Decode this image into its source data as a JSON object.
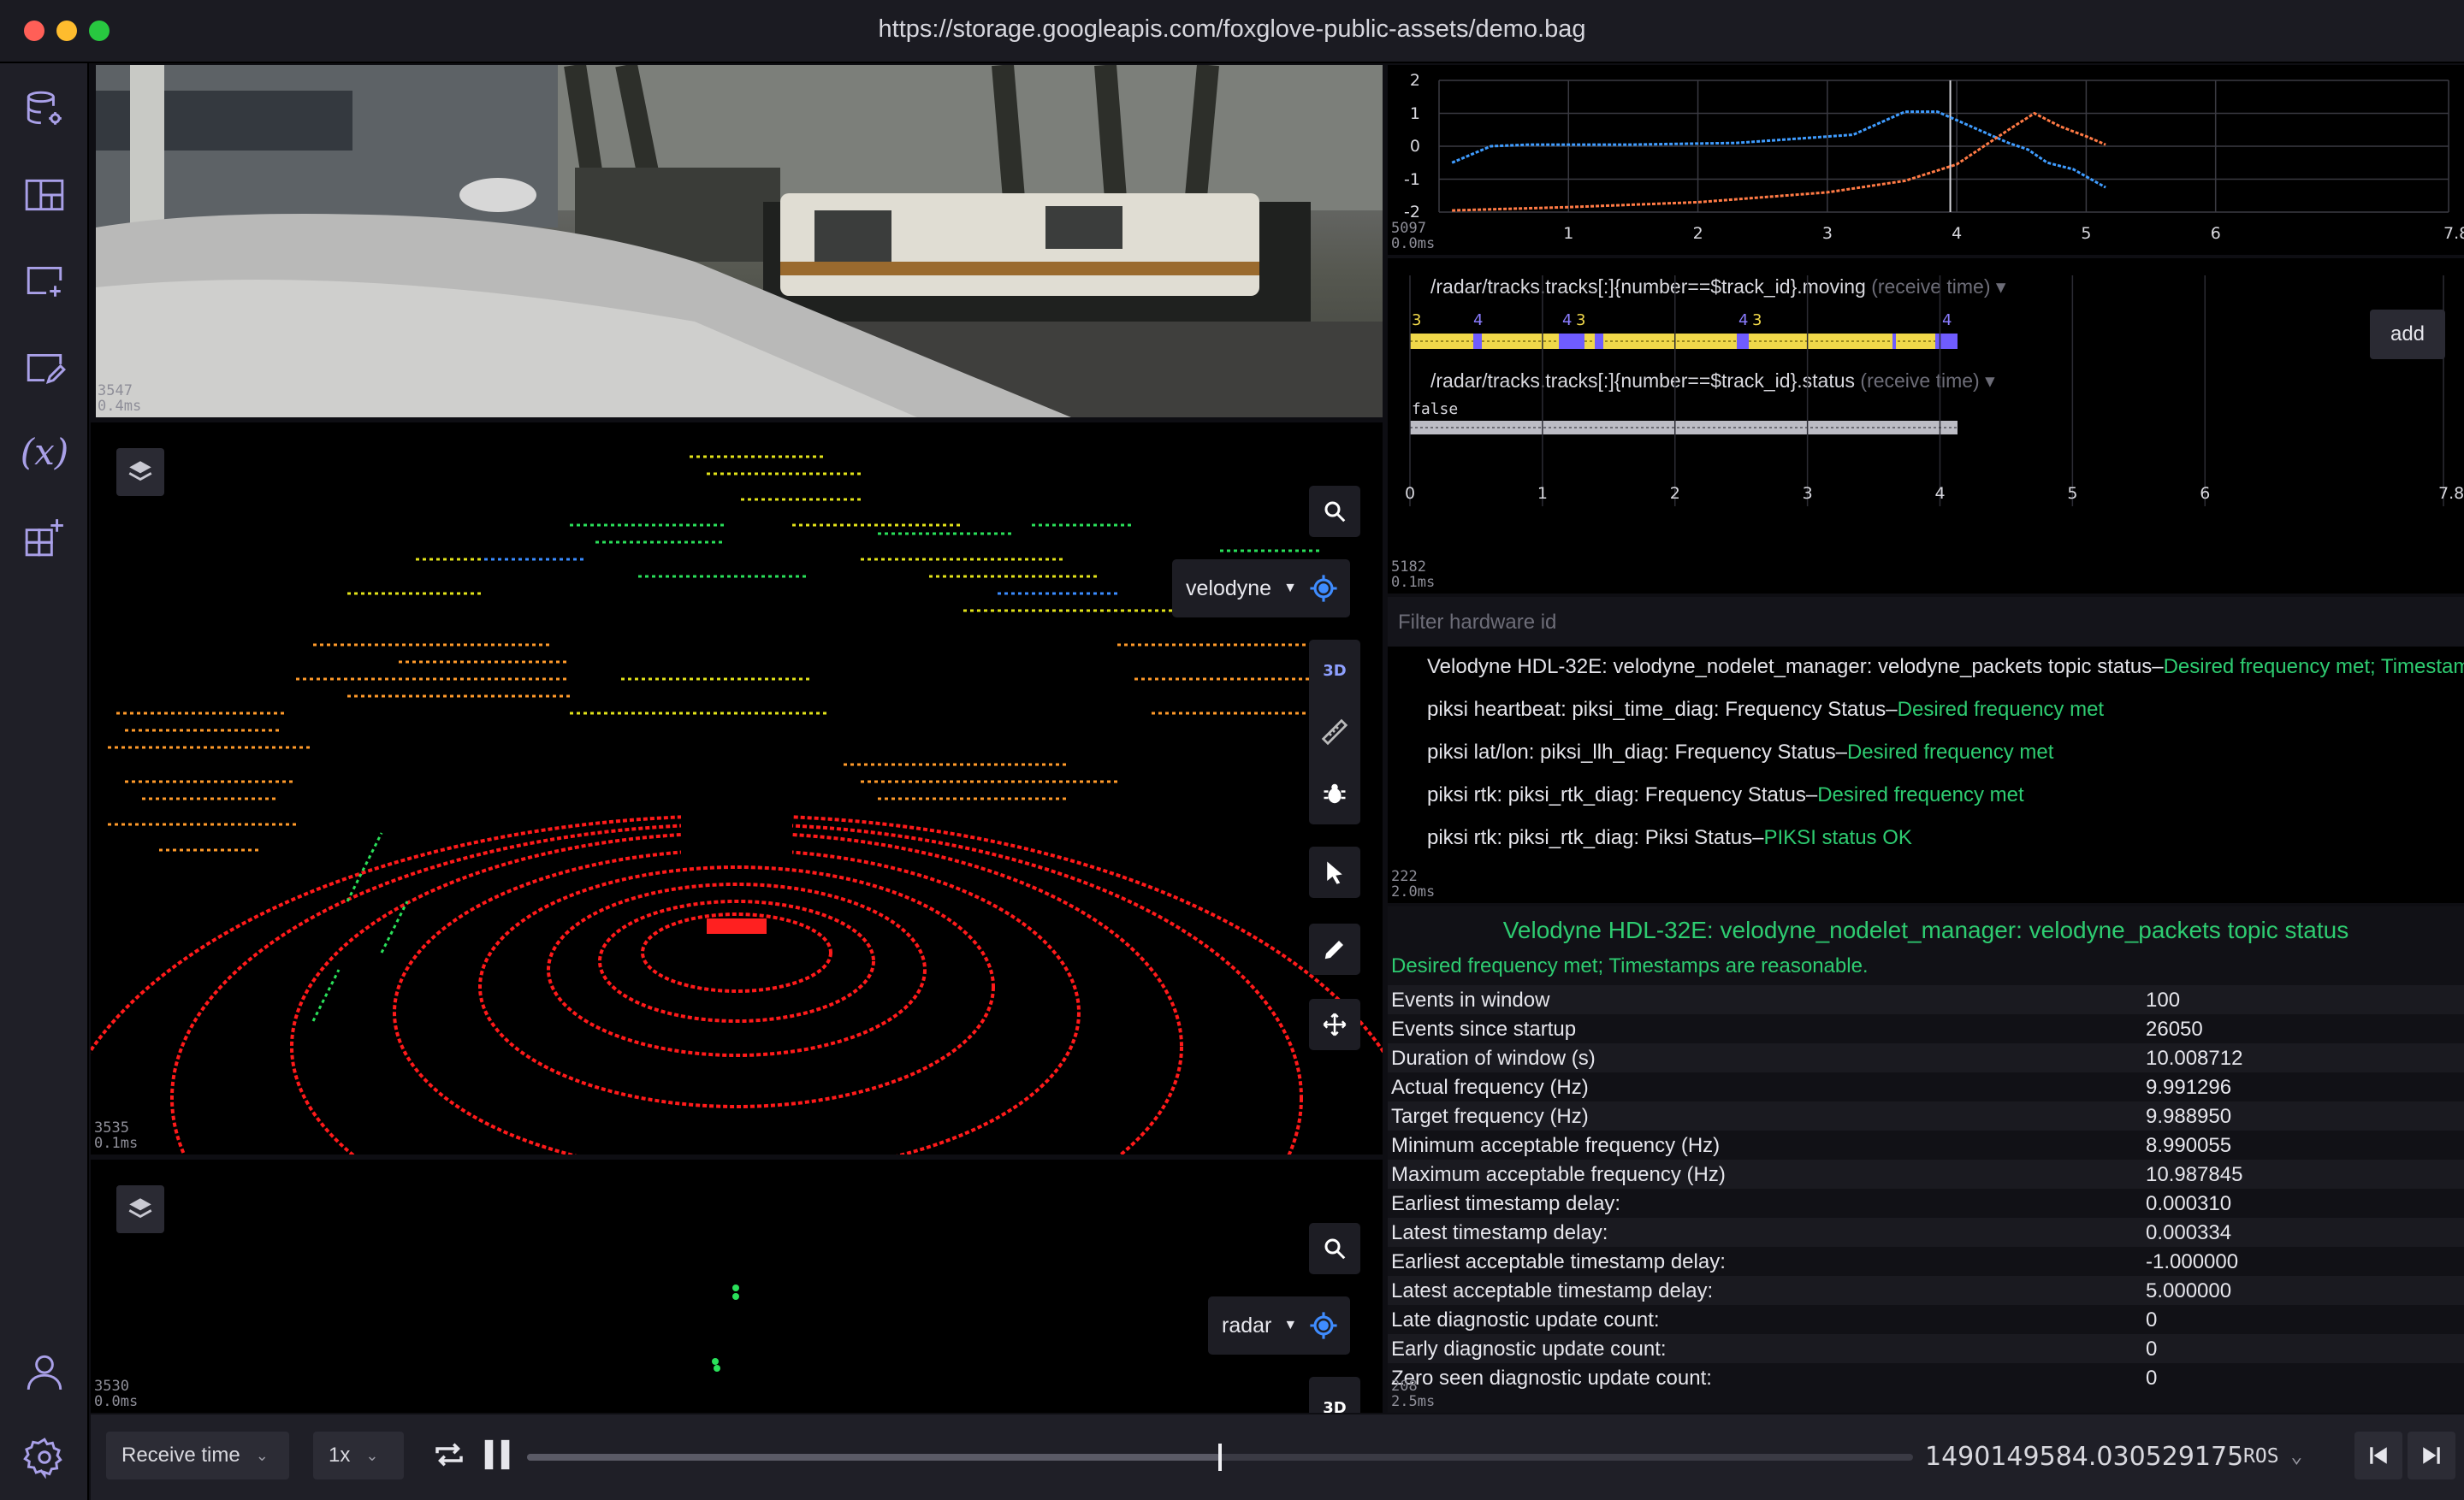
{
  "window": {
    "title": "https://storage.googleapis.com/foxglove-public-assets/demo.bag"
  },
  "sidebar": {
    "items": [
      {
        "icon": "database-settings-icon"
      },
      {
        "icon": "layout-grid-icon"
      },
      {
        "icon": "add-panel-icon"
      },
      {
        "icon": "edit-note-icon"
      },
      {
        "icon": "variables-icon",
        "label": "(x)"
      },
      {
        "icon": "extensions-icon"
      }
    ],
    "bottom": [
      {
        "icon": "user-icon"
      },
      {
        "icon": "settings-gear-icon"
      }
    ]
  },
  "camera_panel": {
    "stat_a": "3547",
    "stat_b": "0.4ms"
  },
  "scene3d": {
    "follow_frame": "velodyne",
    "mode_label": "3D",
    "stat_a": "3535",
    "stat_b": "0.1ms"
  },
  "radar3d": {
    "follow_frame": "radar",
    "mode_label": "3D",
    "stat_a": "3530",
    "stat_b": "0.0ms"
  },
  "plot_panel": {
    "stat_a": "5097",
    "stat_b": "0.0ms",
    "y_ticks": [
      "2",
      "1",
      "0",
      "-1",
      "-2"
    ],
    "x_ticks": [
      "1",
      "2",
      "3",
      "4",
      "5",
      "6",
      "7.8"
    ],
    "chart_data": {
      "type": "line",
      "ylim": [
        -2,
        2
      ],
      "xlim": [
        0,
        7.8
      ],
      "series": [
        {
          "color": "#3f9cff",
          "x": [
            0.1,
            0.4,
            0.7,
            1.5,
            2.3,
            3.2,
            3.4,
            3.6,
            3.85,
            4.4,
            4.55,
            4.7,
            4.9,
            5.15
          ],
          "y": [
            -0.5,
            0,
            0.05,
            0.05,
            0.1,
            0.35,
            0.7,
            1.05,
            1.05,
            0.1,
            -0.1,
            -0.5,
            -0.7,
            -1.25
          ]
        },
        {
          "color": "#ff7a45",
          "x": [
            0.1,
            1.0,
            2.0,
            3.0,
            3.6,
            4.0,
            4.4,
            4.6,
            4.8,
            5.0,
            5.15
          ],
          "y": [
            -1.95,
            -1.85,
            -1.7,
            -1.4,
            -1.05,
            -0.55,
            0.5,
            1.0,
            0.6,
            0.3,
            0.05
          ]
        }
      ]
    }
  },
  "state_panel": {
    "stat_a": "5182",
    "stat_b": "0.1ms",
    "add_label": "add",
    "rows": [
      {
        "topic": "/radar/tracks.tracks[:]{number==$track_id}.moving",
        "sub": "(receive time)",
        "labels": [
          "3",
          "4",
          "4",
          "3",
          "4",
          "3",
          "4"
        ]
      },
      {
        "topic": "/radar/tracks.tracks[:]{number==$track_id}.status",
        "sub": "(receive time)",
        "labels": [
          "false"
        ]
      }
    ],
    "x_ticks": [
      "0",
      "1",
      "2",
      "3",
      "4",
      "5",
      "6",
      "7.8"
    ]
  },
  "diagnostics": {
    "filter_placeholder": "Filter hardware id",
    "stat_a": "222",
    "stat_b": "2.0ms",
    "rows": [
      {
        "name": "Velodyne HDL-32E: velodyne_nodelet_manager: velodyne_packets topic status",
        "sep": "–",
        "status": "Desired frequency met; Timestamps are reasonable."
      },
      {
        "name": "piksi heartbeat: piksi_time_diag: Frequency Status",
        "sep": "–",
        "status": "Desired frequency met"
      },
      {
        "name": "piksi lat/lon: piksi_llh_diag: Frequency Status",
        "sep": "–",
        "status": "Desired frequency met"
      },
      {
        "name": "piksi rtk: piksi_rtk_diag: Frequency Status",
        "sep": "–",
        "status": "Desired frequency met"
      },
      {
        "name": "piksi rtk: piksi_rtk_diag: Piksi Status",
        "sep": "–",
        "status": "PIKSI status OK"
      }
    ]
  },
  "detail": {
    "title": "Velodyne HDL-32E: velodyne_nodelet_manager: velodyne_packets topic status",
    "message": "Desired frequency met; Timestamps are reasonable.",
    "stat_a": "208",
    "stat_b": "2.5ms",
    "rows": [
      {
        "k": "Events in window",
        "v": "100"
      },
      {
        "k": "Events since startup",
        "v": "26050"
      },
      {
        "k": "Duration of window (s)",
        "v": "10.008712"
      },
      {
        "k": "Actual frequency (Hz)",
        "v": "9.991296"
      },
      {
        "k": "Target frequency (Hz)",
        "v": "9.988950"
      },
      {
        "k": "Minimum acceptable frequency (Hz)",
        "v": "8.990055"
      },
      {
        "k": "Maximum acceptable frequency (Hz)",
        "v": "10.987845"
      },
      {
        "k": "Earliest timestamp delay:",
        "v": "0.000310"
      },
      {
        "k": "Latest timestamp delay:",
        "v": "0.000334"
      },
      {
        "k": "Earliest acceptable timestamp delay:",
        "v": "-1.000000"
      },
      {
        "k": "Latest acceptable timestamp delay:",
        "v": "5.000000"
      },
      {
        "k": "Late diagnostic update count:",
        "v": "0"
      },
      {
        "k": "Early diagnostic update count:",
        "v": "0"
      },
      {
        "k": "Zero seen diagnostic update count:",
        "v": "0"
      }
    ]
  },
  "playback": {
    "time_mode": "Receive time",
    "speed": "1x",
    "timestamp": "1490149584.030529175",
    "format": "ROS",
    "progress": 0.5
  }
}
